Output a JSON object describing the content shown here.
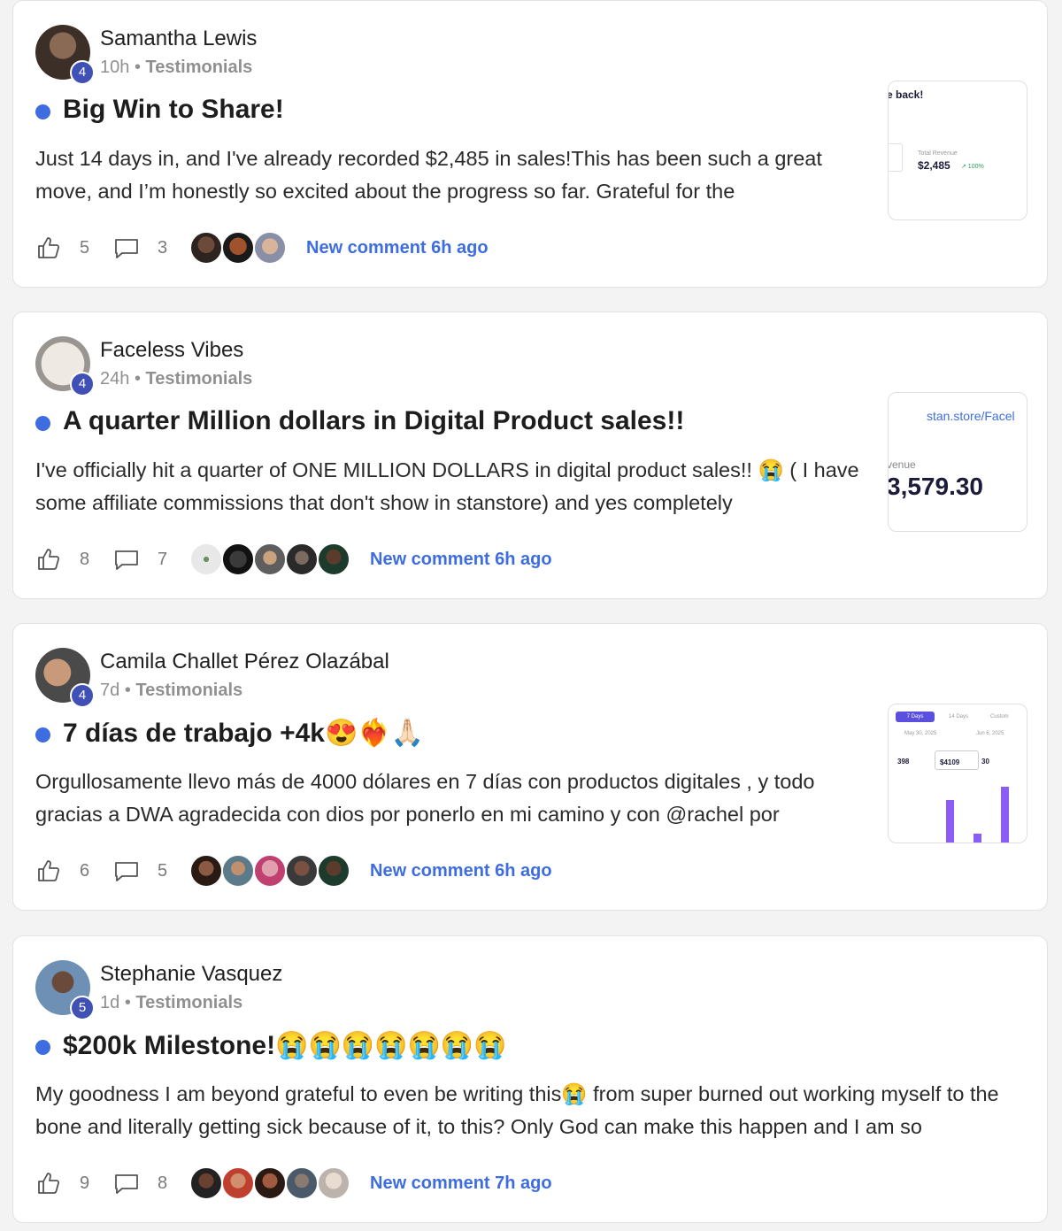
{
  "posts": [
    {
      "author": "Samantha Lewis",
      "level": "4",
      "time": "10h",
      "separator": "•",
      "category": "Testimonials",
      "title": "Big Win to Share!",
      "body": "Just 14 days in, and I've already recorded $2,485 in sales!This has been such a great move, and I’m honestly so excited about the progress so far. Grateful for the",
      "likes": "5",
      "comments": "3",
      "new_comment": "New comment 6h ago",
      "thumb": {
        "line1": "e back!",
        "line2": "Total Revenue",
        "value": "$2,485",
        "change": "↗ 100%"
      }
    },
    {
      "author": "Faceless Vibes",
      "level": "4",
      "time": "24h",
      "separator": "•",
      "category": "Testimonials",
      "title": "A quarter Million dollars in Digital Product sales!!",
      "body": "I've officially hit a quarter of ONE MILLION DOLLARS in digital product sales!! 😭 ( I have some affiliate commissions that don't show in stanstore) and yes completely",
      "likes": "8",
      "comments": "7",
      "new_comment": "New comment 6h ago",
      "thumb": {
        "line1": "stan.store/Facel",
        "line2": "venue",
        "value": "3,579.30"
      }
    },
    {
      "author": "Camila Challet Pérez Olazábal",
      "level": "4",
      "time": "7d",
      "separator": "•",
      "category": "Testimonials",
      "title": "7 días de trabajo +4k😍❤️‍🔥🙏🏻",
      "body": "Orgullosamente llevo más de 4000 dólares en 7 días con productos digitales , y todo gracias a DWA agradecida con dios por ponerlo en mi camino y con @rachel por",
      "likes": "6",
      "comments": "5",
      "new_comment": "New comment 6h ago",
      "thumb": {
        "tabs": [
          "7 Days",
          "14 Days",
          "Custom"
        ],
        "date_from": "May 30, 2025",
        "date_to": "Jun 6, 2025",
        "stats": [
          "398",
          "$4109",
          "30"
        ]
      }
    },
    {
      "author": "Stephanie Vasquez",
      "level": "5",
      "time": "1d",
      "separator": "•",
      "category": "Testimonials",
      "title": "$200k Milestone!😭😭😭😭😭😭😭",
      "body": "My goodness I am beyond grateful to even be writing this😭 from super burned out working myself to the bone and literally getting sick because of it, to this? Only God can make this happen and I am so",
      "likes": "9",
      "comments": "8",
      "new_comment": "New comment 7h ago"
    }
  ],
  "colors": {
    "accent": "#3d6de0",
    "level_badge": "#3f51b5",
    "chart_bar": "#8b5cf6"
  },
  "icons": {
    "like": "thumbs-up-icon",
    "comment": "comment-bubble-icon"
  }
}
